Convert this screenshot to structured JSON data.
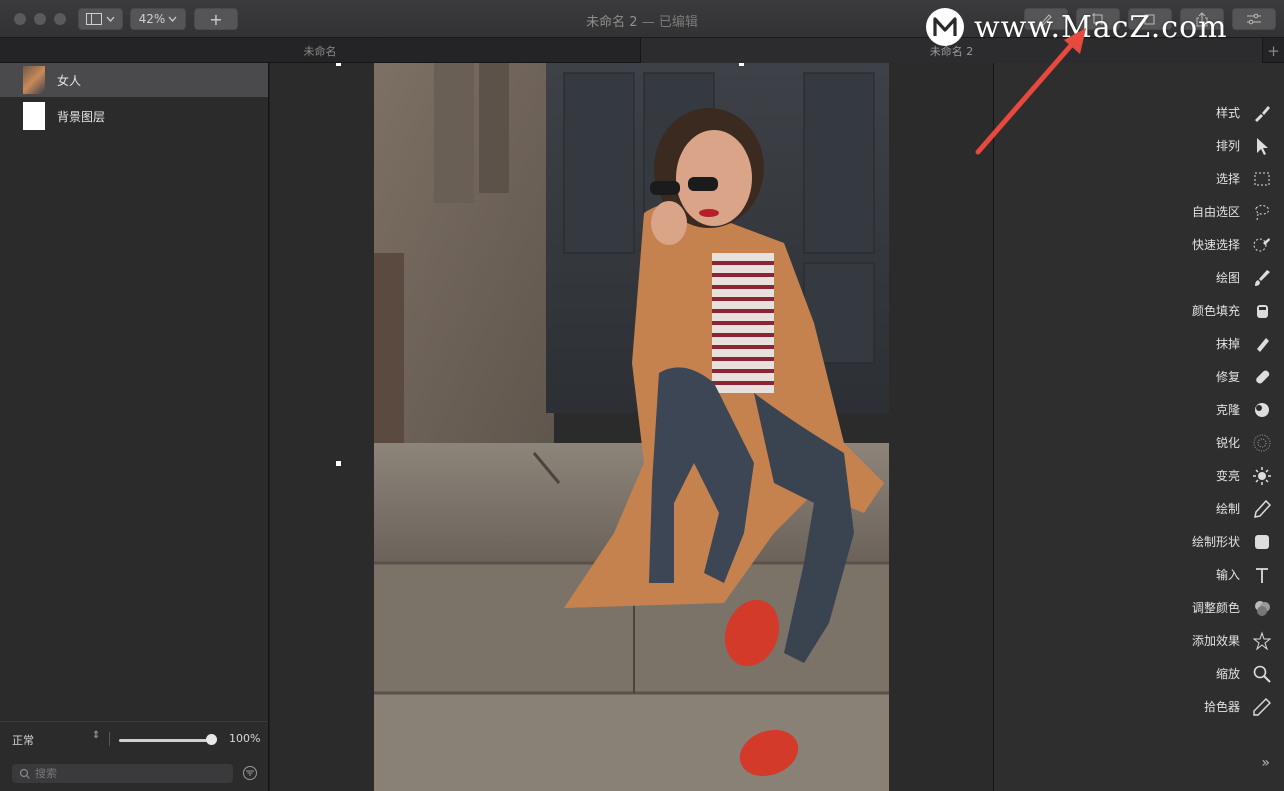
{
  "window": {
    "zoom": "42%",
    "title": "未命名 2",
    "subtitle": "— 已编辑"
  },
  "tabs": [
    {
      "label": "未命名",
      "active": false
    },
    {
      "label": "未命名 2",
      "active": true
    }
  ],
  "layers": [
    {
      "name": "女人",
      "selected": true
    },
    {
      "name": "背景图层",
      "selected": false
    }
  ],
  "layer_panel": {
    "blend_mode": "正常",
    "opacity": "100%",
    "opacity_fraction": 1.0,
    "search_placeholder": "搜索"
  },
  "tools": [
    {
      "label": "样式",
      "icon": "brush-style-icon"
    },
    {
      "label": "排列",
      "icon": "cursor-arrow-icon"
    },
    {
      "label": "选择",
      "icon": "marquee-icon"
    },
    {
      "label": "自由选区",
      "icon": "lasso-icon"
    },
    {
      "label": "快速选择",
      "icon": "quick-select-icon"
    },
    {
      "label": "绘图",
      "icon": "paintbrush-icon"
    },
    {
      "label": "颜色填充",
      "icon": "bucket-icon"
    },
    {
      "label": "抹掉",
      "icon": "eraser-icon"
    },
    {
      "label": "修复",
      "icon": "bandage-icon"
    },
    {
      "label": "克隆",
      "icon": "clone-icon"
    },
    {
      "label": "锐化",
      "icon": "sharpen-icon"
    },
    {
      "label": "变亮",
      "icon": "sun-icon"
    },
    {
      "label": "绘制",
      "icon": "pen-icon"
    },
    {
      "label": "绘制形状",
      "icon": "shape-icon"
    },
    {
      "label": "输入",
      "icon": "text-icon"
    },
    {
      "label": "调整颜色",
      "icon": "color-circles-icon"
    },
    {
      "label": "添加效果",
      "icon": "star-effect-icon"
    },
    {
      "label": "缩放",
      "icon": "magnifier-icon"
    },
    {
      "label": "拾色器",
      "icon": "eyedropper-icon"
    }
  ],
  "more_label": "»",
  "watermark": {
    "text": "www.MacZ.com",
    "logo": "M"
  },
  "colors": {
    "accent_arrow": "#e8493f",
    "panel": "#2e2e2e",
    "selected_row": "#4a4a4c"
  }
}
